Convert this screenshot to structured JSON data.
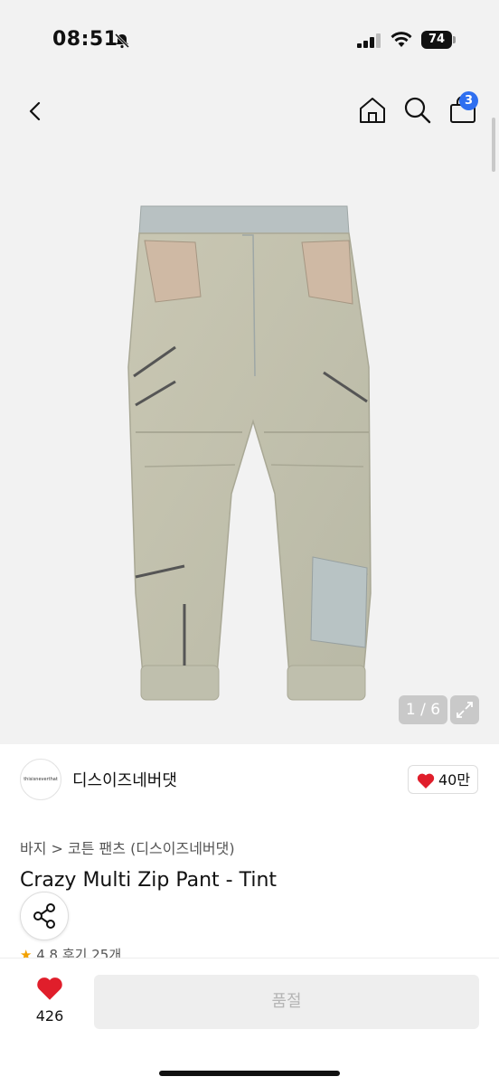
{
  "status_bar": {
    "time": "08:51",
    "battery": "74"
  },
  "header": {
    "cart_count": "3"
  },
  "gallery": {
    "counter": "1 / 6"
  },
  "brand": {
    "logo_text": "thisisneverthat",
    "name": "디스이즈네버댓",
    "likes": "40만"
  },
  "product": {
    "breadcrumb": "바지 > 코튼 팬츠 (디스이즈네버댓)",
    "title": "Crazy Multi Zip Pant - Tint",
    "rating": "4.8",
    "reviews": "후기 25개"
  },
  "bottom": {
    "wish_count": "426",
    "buy_label": "품절"
  },
  "colors": {
    "accent": "#2f6ff0",
    "heart": "#e01e2b",
    "star": "#f2a100",
    "disabled_bg": "#eeeeee"
  }
}
